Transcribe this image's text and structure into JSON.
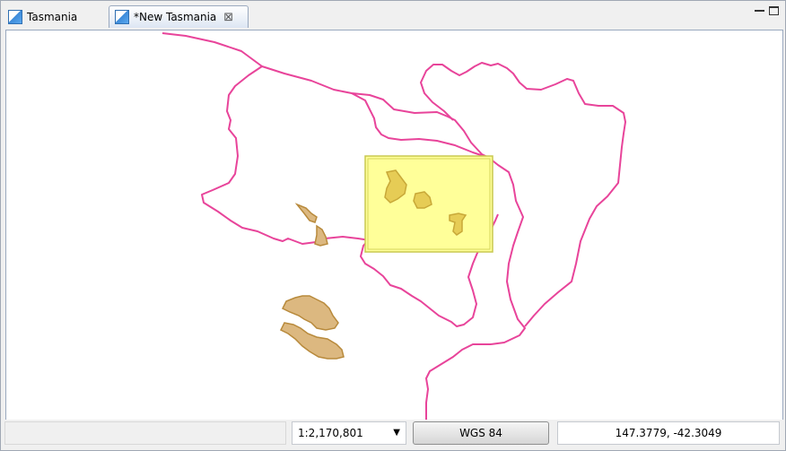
{
  "tabs": [
    {
      "label": "Tasmania",
      "icon": "map-icon",
      "active": false
    },
    {
      "label": "*New Tasmania",
      "icon": "map-icon",
      "active": true,
      "close_icon": "close-icon"
    }
  ],
  "window_controls": [
    "minimize-icon",
    "maximize-icon"
  ],
  "map": {
    "colors": {
      "route": "#e8449a",
      "selection_fill": "#ffff99",
      "selection_stroke": "#c8c850",
      "lake_fill": "#dcb880",
      "lake_stroke": "#b88a3c",
      "selected_lake_fill": "#e6cc55"
    }
  },
  "statusbar": {
    "scale": "1:2,170,801",
    "crs": "WGS 84",
    "coordinates": "147.3779, -42.3049"
  }
}
